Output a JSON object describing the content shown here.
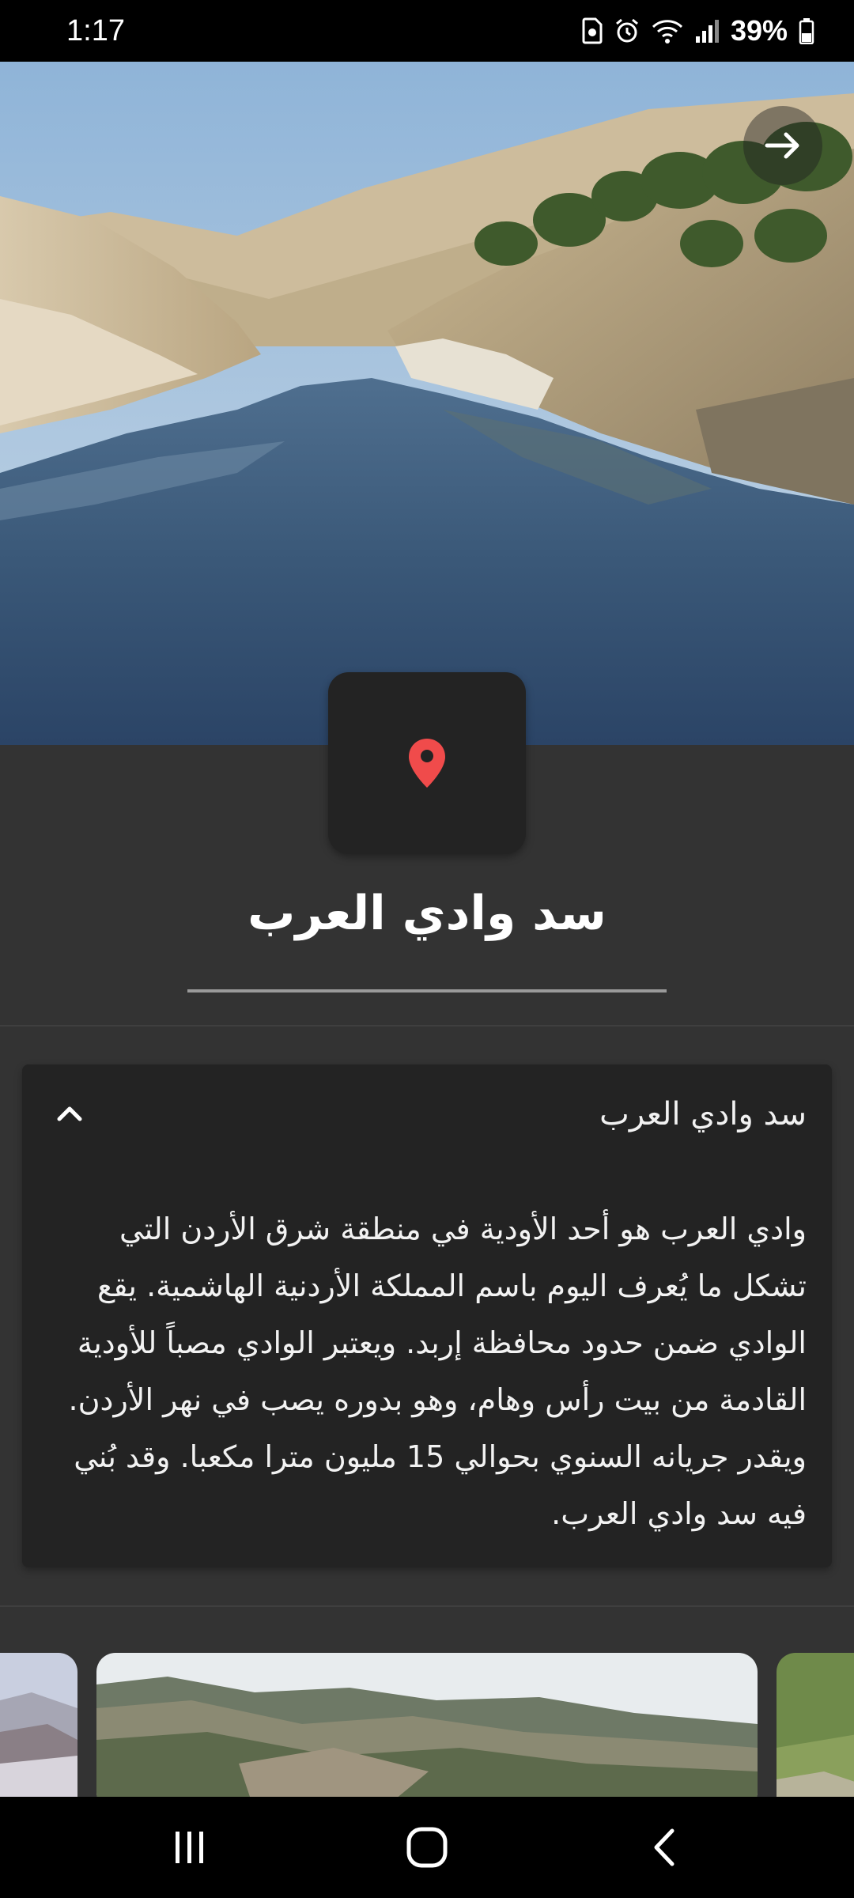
{
  "status_bar": {
    "time": "1:17",
    "battery": "39%",
    "icons": [
      "sim-icon",
      "alarm-icon",
      "wifi-icon",
      "signal-icon",
      "battery-icon"
    ]
  },
  "hero": {
    "image": "valley-lake-photo",
    "next_icon": "arrow-right-icon"
  },
  "location": {
    "icon": "map-pin-icon",
    "pin_color": "#f04b4b"
  },
  "place": {
    "title": "سد وادي العرب"
  },
  "description_card": {
    "title": "سد وادي العرب",
    "toggle_icon": "chevron-up-icon",
    "body": "وادي العرب هو أحد الأودية في منطقة شرق الأردن التي تشكل ما يُعرف اليوم باسم المملكة الأردنية الهاشمية. يقع الوادي ضمن حدود محافظة إربد. ويعتبر الوادي مصباً للأودية القادمة من بيت رأس وهام، وهو بدوره يصب في نهر الأردن. ويقدر جريانه السنوي بحوالي 15 مليون مترا مكعبا. وقد بُني فيه سد وادي العرب."
  },
  "gallery": {
    "items": [
      "snowy-hills-photo",
      "mountain-slopes-photo",
      "green-hill-photo"
    ]
  },
  "nav_bar": {
    "icons": [
      "recents-icon",
      "home-icon",
      "back-icon"
    ]
  },
  "colors": {
    "background": "#333333",
    "card": "#232323",
    "accent_pin": "#f04b4b"
  }
}
